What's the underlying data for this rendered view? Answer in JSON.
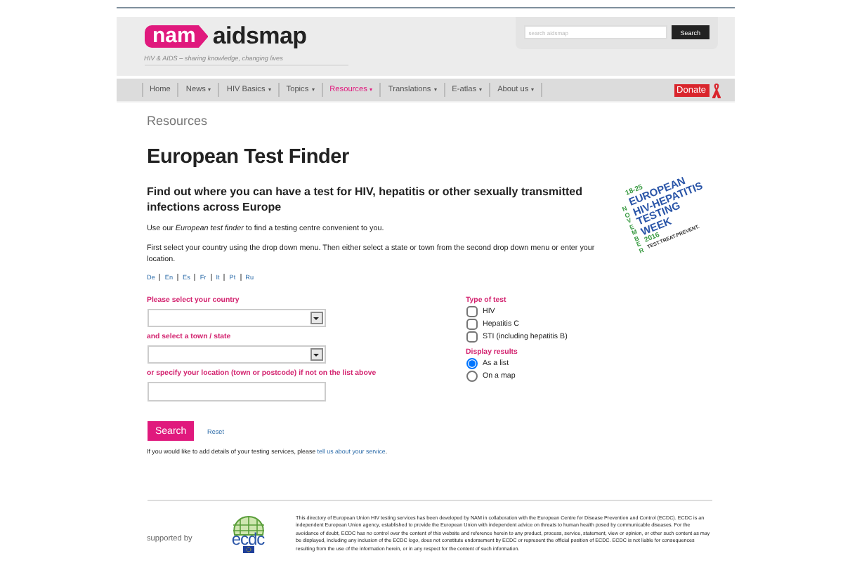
{
  "header": {
    "logo_mark": "nam",
    "logo_name": "aidsmap",
    "tagline": "HIV & AIDS – sharing knowledge, changing lives",
    "search": {
      "placeholder": "search aidsmap",
      "button": "Search"
    }
  },
  "nav": {
    "items": [
      {
        "label": "Home",
        "dropdown": false,
        "selected": false
      },
      {
        "label": "News",
        "dropdown": true,
        "selected": false
      },
      {
        "label": "HIV Basics",
        "dropdown": true,
        "selected": false
      },
      {
        "label": "Topics",
        "dropdown": true,
        "selected": false
      },
      {
        "label": "Resources",
        "dropdown": true,
        "selected": true
      },
      {
        "label": "Translations",
        "dropdown": true,
        "selected": false
      },
      {
        "label": "E-atlas",
        "dropdown": true,
        "selected": false
      },
      {
        "label": "About us",
        "dropdown": true,
        "selected": false
      }
    ],
    "donate": "Donate"
  },
  "breadcrumb": "Resources",
  "title": "European Test Finder",
  "intro": "Find out where you can have a test for HIV, hepatitis or other sexually transmitted infections across Europe",
  "paragraphs": [
    "Use our *European test finder* to find a testing centre convenient to you.",
    "First select your country using the drop down menu. Then either select a state or town from the second drop down menu or enter your location."
  ],
  "languages": [
    "De",
    "En",
    "Es",
    "Fr",
    "It",
    "Pt",
    "Ru"
  ],
  "badge": {
    "dates": "18-25",
    "month": "NOVEMBER",
    "lines": [
      "EUROPEAN",
      "HIV-HEPATITIS",
      "TESTING",
      "WEEK"
    ],
    "year": "2016",
    "slogan": "TEST.TREAT.PREVENT."
  },
  "form": {
    "country_label": "Please select your country",
    "town_label": "and select a town / state",
    "location_label": "or specify your location (town or postcode) if not on the list above",
    "test_type": {
      "title": "Type of test",
      "options": [
        {
          "label": "HIV",
          "checked": false
        },
        {
          "label": "Hepatitis C",
          "checked": false
        },
        {
          "label": "STI (including hepatitis B)",
          "checked": false
        }
      ]
    },
    "display": {
      "title": "Display results",
      "options": [
        {
          "label": "As a list",
          "selected": true
        },
        {
          "label": "On a map",
          "selected": false
        }
      ]
    },
    "search_button": "Search",
    "reset": "Reset"
  },
  "add_services": {
    "text": "If you would like to add details of your testing services, please ",
    "link": "tell us about your service",
    "end": "."
  },
  "footer": {
    "supported_by": "supported by",
    "logo": "ecdc",
    "disclaimer": "This directory of European Union HIV testing services has been developed by NAM in collaboration with the European Centre for Disease Prevention and Control (ECDC). ECDC is an independent European Union agency, established to provide the European Union with independent advice on threats to human health posed by communicable diseases. For the avoidance of doubt, ECDC has no control over the content of this website and reference herein to any product, process, service, statement, view or opinion, or other such content as may be displayed, including any inclusion of the ECDC logo, does not constitute endorsement by ECDC or represent the official position of ECDC. ECDC is not liable for consequences resulting from the use of the information herein, or in any respect for the content of such information."
  }
}
